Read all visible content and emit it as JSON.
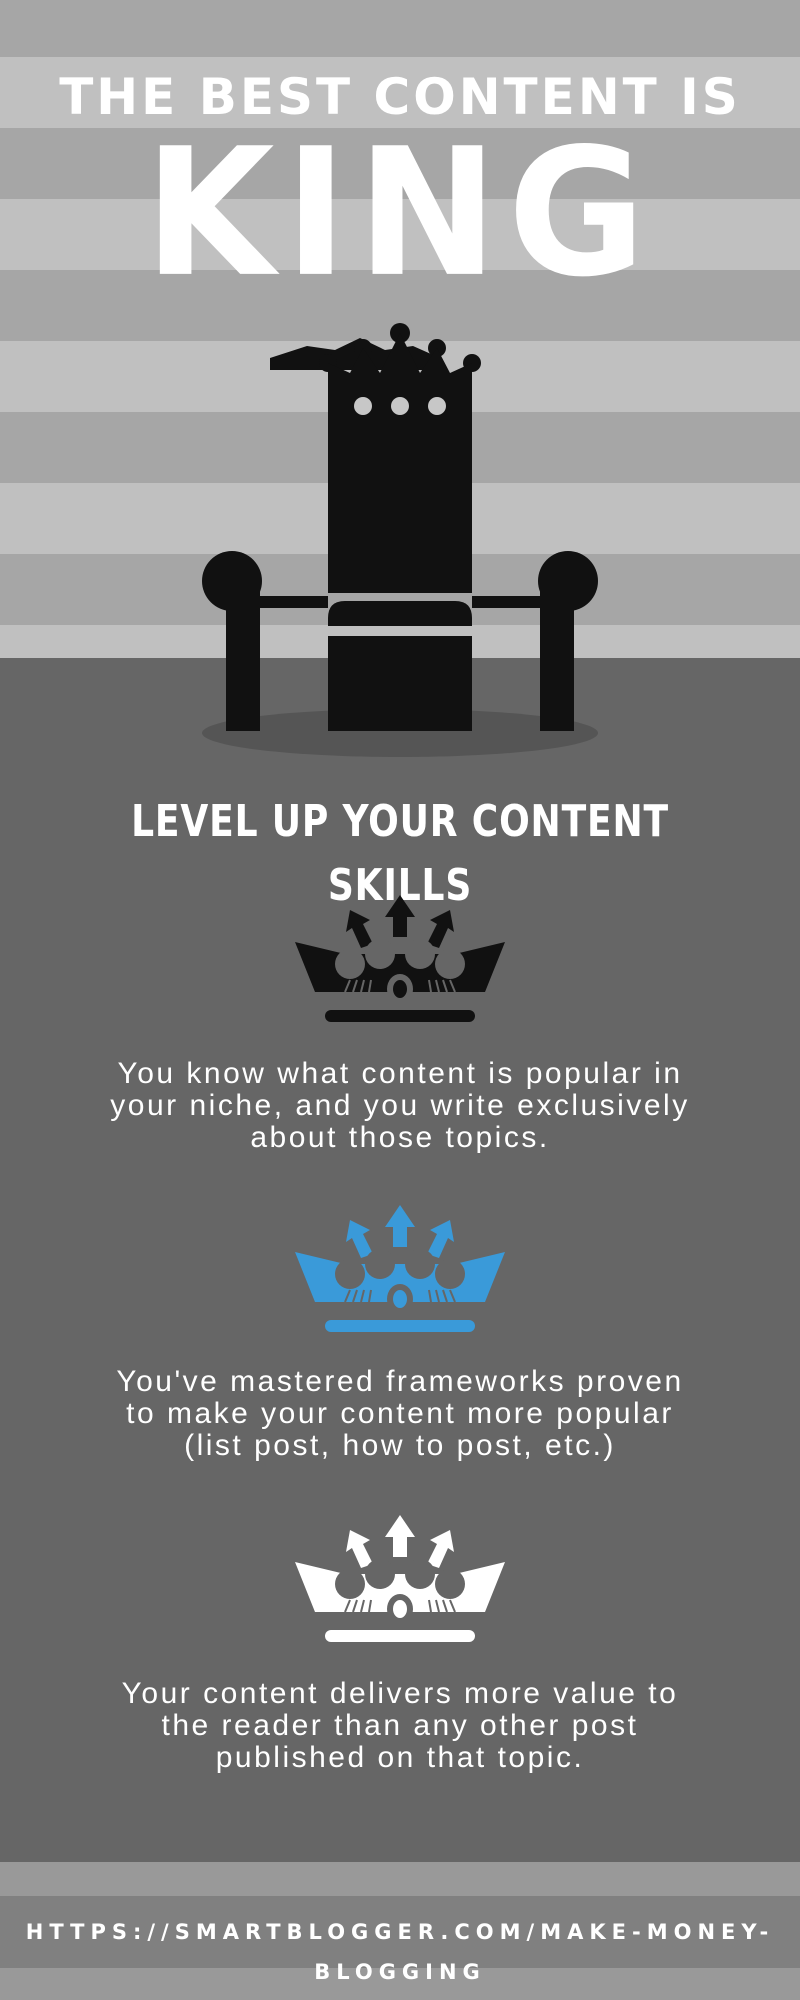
{
  "header": {
    "tagline": "THE BEST CONTENT IS",
    "highlight": "KING"
  },
  "section": {
    "title": "LEVEL UP YOUR CONTENT SKILLS"
  },
  "skills": [
    {
      "icon": "crown-icon",
      "crown_color": "#111111",
      "line1": "You know what content is popular in",
      "line2": "your niche, and you write exclusively",
      "line3": "about those topics."
    },
    {
      "icon": "crown-icon",
      "crown_color": "#3a9ad9",
      "line1": "You've mastered frameworks proven",
      "line2": "to make your content more popular",
      "line3": "(list post, how to post, etc.)"
    },
    {
      "icon": "crown-icon",
      "crown_color": "#ffffff",
      "line1": "Your content delivers more value to",
      "line2": "the reader than any other post",
      "line3": "published on that topic."
    }
  ],
  "footer": {
    "url": "HTTPS://SMARTBLOGGER.COM/MAKE-MONEY-BLOGGING"
  },
  "colors": {
    "hero_stripe_dark": "#a6a6a6",
    "hero_stripe_light": "#c0c0c0",
    "body_background": "#666666",
    "throne": "#111111",
    "accent_blue": "#3a9ad9"
  }
}
